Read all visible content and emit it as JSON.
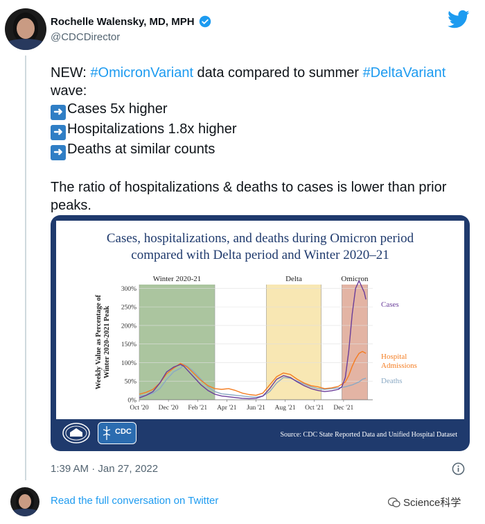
{
  "author": {
    "name": "Rochelle Walensky, MD, MPH",
    "handle": "@CDCDirector"
  },
  "tweet": {
    "line1_prefix": "NEW: ",
    "hashtag1": "#OmicronVariant",
    "line1_mid": " data compared to summer ",
    "hashtag2": "#DeltaVariant",
    "line1_suffix": " wave:",
    "bullets": [
      "Cases 5x higher",
      "Hospitalizations 1.8x higher",
      "Deaths at similar counts"
    ],
    "closing": "The ratio of hospitalizations & deaths to cases is lower than prior peaks."
  },
  "media": {
    "source": "Source: CDC State Reported Data and Unified Hospital Dataset",
    "cdc_logo_text": "CDC"
  },
  "chart_data": {
    "type": "line",
    "title_line1": "Cases, hospitalizations, and deaths during Omicron period",
    "title_line2": "compared with Delta period and Winter 2020–21",
    "ylabel_line1": "Weekly Value as Percentage of",
    "ylabel_line2": "Winter 2020-2021 Peak",
    "y_ticks": [
      "0%",
      "50%",
      "100%",
      "150%",
      "200%",
      "250%",
      "300%"
    ],
    "ylim": [
      0,
      310
    ],
    "x_ticks": [
      "Oct '20",
      "Dec '20",
      "Feb '21",
      "Apr '21",
      "Jun '21",
      "Aug '21",
      "Oct '21",
      "Dec '21"
    ],
    "x_tick_positions": [
      0,
      8.5,
      17,
      25.5,
      34,
      42.5,
      51,
      59.5
    ],
    "xlim": [
      0,
      68
    ],
    "periods": [
      {
        "name": "Winter 2020-21",
        "start": 0,
        "end": 22,
        "color": "#8fb27f"
      },
      {
        "name": "Delta",
        "start": 37,
        "end": 53,
        "color": "#f6df9a"
      },
      {
        "name": "Omicron",
        "start": 59,
        "end": 66.5,
        "color": "#d99b86"
      }
    ],
    "series": [
      {
        "name": "Cases",
        "color": "#6a3d9a",
        "x": [
          0,
          2,
          4,
          6,
          8,
          10,
          12,
          13,
          14,
          16,
          18,
          20,
          22,
          24,
          26,
          28,
          30,
          32,
          34,
          36,
          38,
          40,
          42,
          44,
          46,
          48,
          50,
          52,
          54,
          56,
          58,
          59,
          60,
          61,
          62,
          63,
          64,
          64.5,
          65,
          65.5,
          66
        ],
        "values": [
          5,
          12,
          22,
          45,
          75,
          88,
          95,
          90,
          80,
          60,
          40,
          25,
          15,
          10,
          8,
          6,
          4,
          3,
          4,
          10,
          30,
          55,
          65,
          60,
          48,
          38,
          30,
          25,
          22,
          24,
          28,
          35,
          60,
          130,
          230,
          300,
          320,
          310,
          300,
          290,
          270
        ]
      },
      {
        "name": "Hospital\nAdmissions",
        "color": "#f47c20",
        "x": [
          0,
          2,
          4,
          6,
          8,
          10,
          12,
          14,
          16,
          18,
          20,
          22,
          24,
          26,
          28,
          30,
          32,
          34,
          36,
          38,
          40,
          42,
          44,
          46,
          48,
          50,
          52,
          54,
          56,
          58,
          60,
          61,
          62,
          63,
          64,
          65,
          66
        ],
        "values": [
          15,
          20,
          28,
          45,
          70,
          85,
          98,
          88,
          70,
          52,
          38,
          30,
          28,
          30,
          25,
          18,
          14,
          12,
          18,
          40,
          62,
          72,
          68,
          55,
          45,
          38,
          35,
          30,
          32,
          36,
          48,
          65,
          90,
          110,
          125,
          130,
          125
        ]
      },
      {
        "name": "Deaths",
        "color": "#8aa9c4",
        "x": [
          0,
          2,
          4,
          6,
          8,
          10,
          12,
          13,
          14,
          16,
          18,
          20,
          22,
          24,
          26,
          28,
          30,
          32,
          34,
          36,
          38,
          40,
          42,
          44,
          46,
          48,
          50,
          52,
          54,
          56,
          58,
          60,
          62,
          64,
          65,
          66
        ],
        "values": [
          10,
          12,
          18,
          30,
          55,
          75,
          85,
          95,
          90,
          75,
          55,
          35,
          22,
          16,
          14,
          12,
          10,
          8,
          7,
          10,
          22,
          45,
          60,
          58,
          50,
          42,
          35,
          30,
          28,
          30,
          32,
          35,
          40,
          48,
          55,
          58
        ]
      }
    ]
  },
  "timestamp": "1:39 AM · Jan 27, 2022",
  "read_link": "Read the full conversation on Twitter",
  "watermark": "Science科学",
  "colors": {
    "link": "#1d9bf0",
    "media_bg": "#1f3a6d",
    "title_navy": "#1f3a6d"
  }
}
